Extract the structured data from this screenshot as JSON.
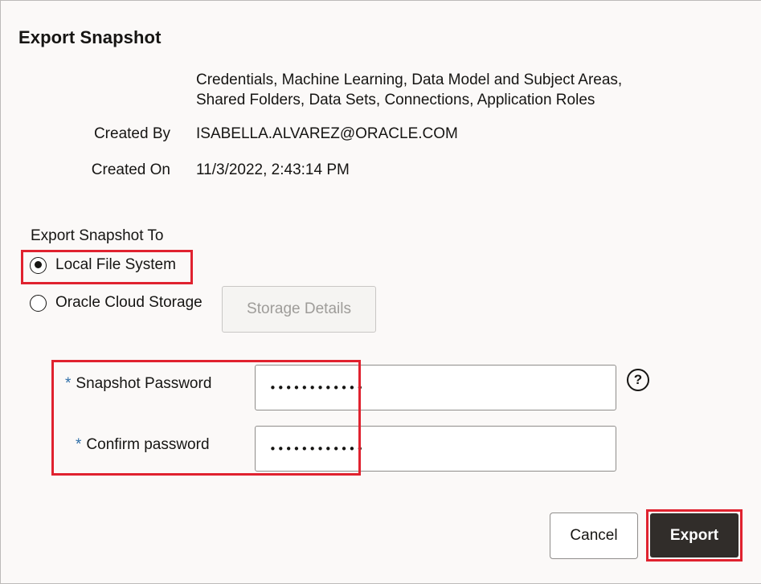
{
  "dialog": {
    "title": "Export Snapshot"
  },
  "details": {
    "content_line1": "Credentials, Machine Learning, Data Model and Subject Areas,",
    "content_line2": "Shared Folders, Data Sets, Connections, Application Roles",
    "created_by_label": "Created By",
    "created_by_value": "ISABELLA.ALVAREZ@ORACLE.COM",
    "created_on_label": "Created On",
    "created_on_value": "11/3/2022, 2:43:14 PM"
  },
  "export_to": {
    "label": "Export Snapshot To",
    "options": [
      {
        "label": "Local File System",
        "selected": true
      },
      {
        "label": "Oracle Cloud Storage",
        "selected": false
      }
    ],
    "storage_details_label": "Storage Details"
  },
  "password": {
    "required_marker": "*",
    "snapshot_label": "Snapshot Password",
    "snapshot_value": "••••••••••••",
    "confirm_label": "Confirm password",
    "confirm_value": "••••••••••••",
    "help_icon": "question-circle-icon",
    "help_glyph": "?"
  },
  "footer": {
    "cancel_label": "Cancel",
    "export_label": "Export"
  },
  "colors": {
    "highlight": "#e0222f",
    "primary_button": "#312d2a",
    "required_marker": "#2f6fa8"
  }
}
